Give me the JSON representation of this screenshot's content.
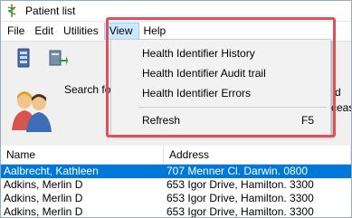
{
  "window": {
    "title": "Patient list",
    "accent_color": "#0078d7",
    "highlight_color": "#e0505a"
  },
  "menubar": {
    "items": [
      {
        "label": "File"
      },
      {
        "label": "Edit"
      },
      {
        "label": "Utilities"
      },
      {
        "label": "View"
      },
      {
        "label": "Help"
      }
    ],
    "active": "View"
  },
  "toolbar": {
    "icons": [
      "database-icon",
      "export-icon"
    ]
  },
  "search": {
    "label": "Search fo",
    "right_fragment_1": "d",
    "right_fragment_2": "ceas"
  },
  "view_menu": {
    "items": [
      {
        "label": "Health Identifier History",
        "shortcut": ""
      },
      {
        "label": "Health Identifier Audit trail",
        "shortcut": ""
      },
      {
        "label": "Health Identifier Errors",
        "shortcut": ""
      },
      {
        "label": "Refresh",
        "shortcut": "F5"
      }
    ]
  },
  "table": {
    "columns": [
      "Name",
      "Address"
    ],
    "rows": [
      {
        "name": "Aalbrecht, Kathleen",
        "address": "707 Menner Cl. Darwin. 0800",
        "selected": true
      },
      {
        "name": "Adkins, Merlin D",
        "address": "653 Igor Drive, Hamilton. 3300",
        "selected": false
      },
      {
        "name": "Adkins, Merlin D",
        "address": "653 Igor Drive, Hamilton. 3300",
        "selected": false
      },
      {
        "name": "Adkins, Merlin D",
        "address": "653 Igor Drive, Hamilton. 3300",
        "selected": false
      }
    ]
  }
}
